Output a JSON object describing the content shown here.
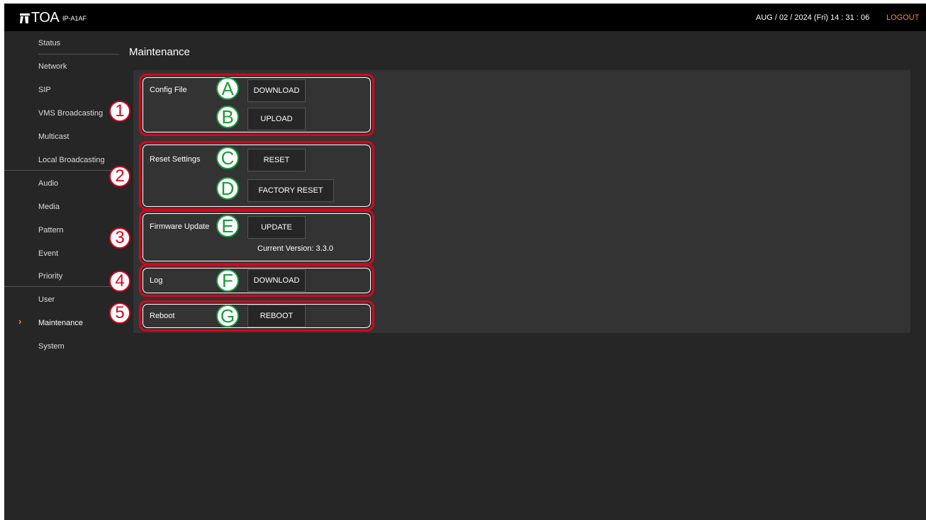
{
  "header": {
    "brand": "TOA",
    "model": "IP-A1AF",
    "datetime": "AUG / 02 / 2024 (Fri)   14 : 31 : 06",
    "logout_label": "LOGOUT"
  },
  "sidebar": {
    "items": [
      {
        "label": "Status"
      },
      {
        "label": "Network"
      },
      {
        "label": "SIP"
      },
      {
        "label": "VMS Broadcasting"
      },
      {
        "label": "Multicast"
      },
      {
        "label": "Local Broadcasting"
      },
      {
        "label": "Audio"
      },
      {
        "label": "Media"
      },
      {
        "label": "Pattern"
      },
      {
        "label": "Event"
      },
      {
        "label": "Priority"
      },
      {
        "label": "User"
      },
      {
        "label": "Maintenance",
        "active": true
      },
      {
        "label": "System"
      }
    ]
  },
  "page": {
    "title": "Maintenance"
  },
  "sections": {
    "config": {
      "callout": "1",
      "label": "Config File",
      "download": {
        "marker": "A",
        "label": "DOWNLOAD"
      },
      "upload": {
        "marker": "B",
        "label": "UPLOAD"
      }
    },
    "reset": {
      "callout": "2",
      "label": "Reset Settings",
      "reset": {
        "marker": "C",
        "label": "RESET"
      },
      "factory": {
        "marker": "D",
        "label": "FACTORY RESET"
      }
    },
    "firmware": {
      "callout": "3",
      "label": "Firmware Update",
      "update": {
        "marker": "E",
        "label": "UPDATE"
      },
      "version": "Current Version: 3.3.0"
    },
    "log": {
      "callout": "4",
      "label": "Log",
      "download": {
        "marker": "F",
        "label": "DOWNLOAD"
      }
    },
    "reboot": {
      "callout": "5",
      "label": "Reboot",
      "reboot": {
        "marker": "G",
        "label": "REBOOT"
      }
    }
  },
  "colors": {
    "background": "#262626",
    "topbar": "#000000",
    "panel": "#333333",
    "accent": "#ff8a1c",
    "callout_red": "#d4061c",
    "marker_green": "#1b9a3c"
  }
}
